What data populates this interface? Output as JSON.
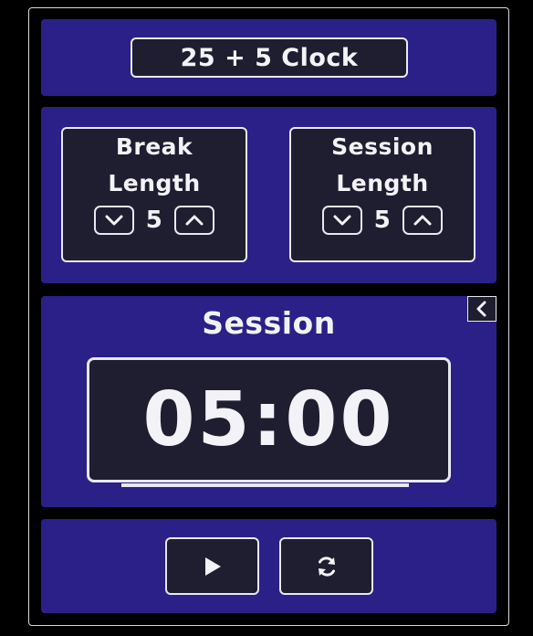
{
  "app": {
    "title": "25 + 5 Clock"
  },
  "break": {
    "label_line1": "Break",
    "label_line2": "Length",
    "value": "5"
  },
  "session": {
    "label_line1": "Session",
    "label_line2": "Length",
    "value": "5"
  },
  "timer": {
    "label": "Session",
    "value": "05:00"
  },
  "controls": {
    "play_icon": "play-icon",
    "reset_icon": "refresh-icon",
    "collapse_icon": "chevron-left-icon"
  },
  "colors": {
    "panel": "#2b2088",
    "box": "#1f1d30",
    "text": "#f3f3f7",
    "background": "#000000"
  }
}
